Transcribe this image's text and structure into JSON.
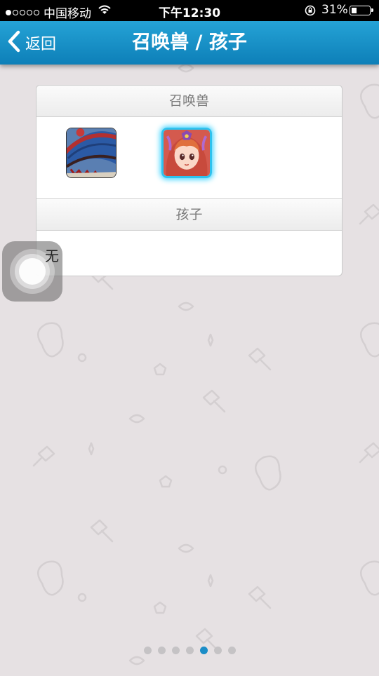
{
  "status_bar": {
    "signal_dots": [
      true,
      false,
      false,
      false,
      false
    ],
    "carrier": "中国移动",
    "wifi_icon": "wifi-icon",
    "time": "下午12:30",
    "rotation_lock_icon": "rotation-lock-icon",
    "battery_percent": "31%",
    "battery_level": 0.31
  },
  "nav": {
    "back_label": "返回",
    "title": "召唤兽 / 孩子",
    "color_top": "#25a3d6",
    "color_bottom": "#0d7fb8"
  },
  "panel": {
    "pets_header": "召唤兽",
    "pets": [
      {
        "icon": "umbrella-pet-avatar",
        "selected": false
      },
      {
        "icon": "girl-pet-avatar",
        "selected": true
      }
    ],
    "children_header": "孩子",
    "children_empty": "无"
  },
  "pager": {
    "count": 7,
    "active_index": 4,
    "active_color": "#1b8dc7"
  }
}
